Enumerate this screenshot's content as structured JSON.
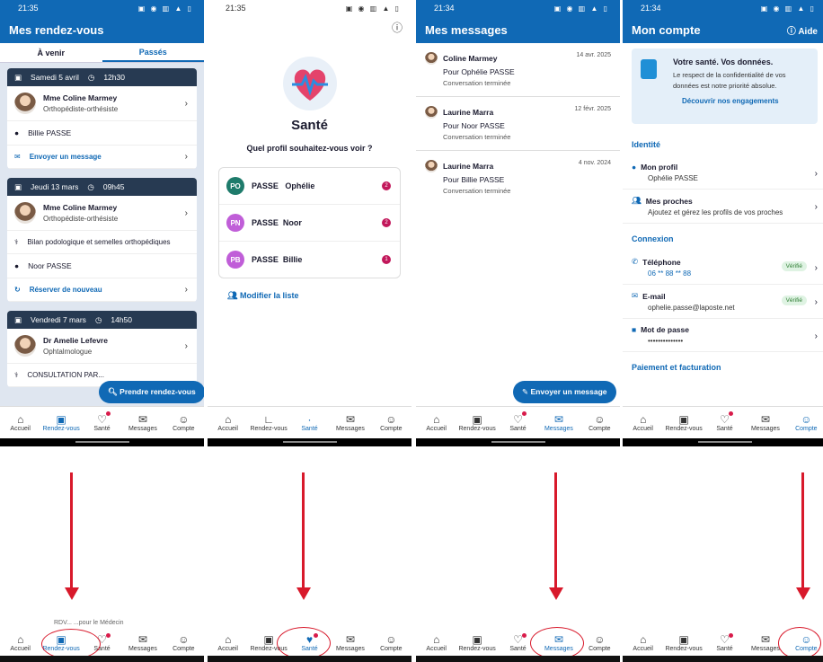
{
  "time1": "21:35",
  "time2": "21:35",
  "time3": "21:34",
  "time4": "21:34",
  "status_icons": "▣ ◉ ▥ ▲ ▯",
  "p1": {
    "title": "Mes rendez-vous",
    "tab_upcoming": "À venir",
    "tab_past": "Passés",
    "cards": [
      {
        "date": "Samedi 5 avril",
        "time": "12h30",
        "name": "Mme Coline Marmey",
        "role": "Orthopédiste-orthésiste",
        "patient": "Billie PASSE",
        "action": "Envoyer un message"
      },
      {
        "date": "Jeudi 13 mars",
        "time": "09h45",
        "name": "Mme Coline Marmey",
        "role": "Orthopédiste-orthésiste",
        "motif": "Bilan podologique et semelles orthopédiques",
        "patient": "Noor PASSE",
        "action": "Réserver de nouveau"
      },
      {
        "date": "Vendredi 7 mars",
        "time": "14h50",
        "name": "Dr Amelie Lefevre",
        "role": "Ophtalmologue",
        "motif": "CONSULTATION PAR..."
      }
    ],
    "fab": "Prendre rendez-vous"
  },
  "p2": {
    "title": "Santé",
    "question": "Quel profil souhaitez-vous voir ?",
    "profiles": [
      {
        "initials": "PO",
        "last": "PASSE",
        "first": "Ophélie",
        "count": "2",
        "color": "#1e7b6b"
      },
      {
        "initials": "PN",
        "last": "PASSE",
        "first": "Noor",
        "count": "2",
        "color": "#c05ed8"
      },
      {
        "initials": "PB",
        "last": "PASSE",
        "first": "Billie",
        "count": "1",
        "color": "#c05ed8"
      }
    ],
    "modify": "Modifier la liste"
  },
  "p3": {
    "title": "Mes messages",
    "messages": [
      {
        "name": "Coline Marmey",
        "date": "14 avr. 2025",
        "for": "Pour  Ophélie PASSE",
        "status": "Conversation terminée"
      },
      {
        "name": "Laurine Marra",
        "date": "12 févr. 2025",
        "for": "Pour  Noor PASSE",
        "status": "Conversation terminée"
      },
      {
        "name": "Laurine Marra",
        "date": "4 nov. 2024",
        "for": "Pour  Billie PASSE",
        "status": "Conversation terminée"
      }
    ],
    "fab": "Envoyer un message"
  },
  "p4": {
    "title": "Mon compte",
    "help": "Aide",
    "info_title": "Votre santé. Vos données.",
    "info_desc": "Le respect de la confidentialité de vos données est notre priorité absolue.",
    "info_link": "Découvrir nos engagements",
    "sec_identity": "Identité",
    "profile_label": "Mon profil",
    "profile_value": "Ophélie PASSE",
    "relatives_label": "Mes proches",
    "relatives_value": "Ajoutez et gérez les profils de vos proches",
    "sec_connexion": "Connexion",
    "phone_label": "Téléphone",
    "phone_value": "06 ** 88 ** 88",
    "verified": "Vérifié",
    "email_label": "E-mail",
    "email_value": "ophelie.passe@laposte.net",
    "password_label": "Mot de passe",
    "password_value": "••••••••••••••",
    "sec_payment": "Paiement et facturation"
  },
  "nav": {
    "home": "Accueil",
    "rdv": "Rendez-vous",
    "sante": "Santé",
    "messages": "Messages",
    "compte": "Compte"
  },
  "cut_text": "RDV... ...pour le Médecin"
}
